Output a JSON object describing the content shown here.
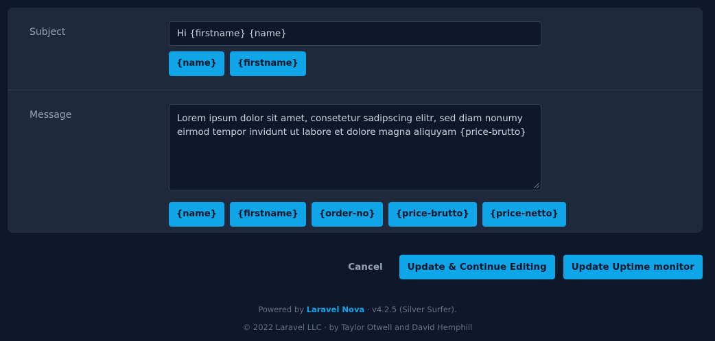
{
  "form": {
    "subject": {
      "label": "Subject",
      "value": "Hi {firstname} {name}",
      "tags": [
        "{name}",
        "{firstname}"
      ]
    },
    "message": {
      "label": "Message",
      "value": "Lorem ipsum dolor sit amet, consetetur sadipscing elitr, sed diam nonumy eirmod tempor invidunt ut labore et dolore magna aliquyam {price-brutto}",
      "tags": [
        "{name}",
        "{firstname}",
        "{order-no}",
        "{price-brutto}",
        "{price-netto}"
      ]
    }
  },
  "actions": {
    "cancel_label": "Cancel",
    "continue_label": "Update & Continue Editing",
    "update_label": "Update Uptime monitor"
  },
  "footer": {
    "powered_prefix": "Powered by",
    "powered_link": "Laravel Nova",
    "powered_suffix": "· v4.2.5 (Silver Surfer).",
    "copyright": "© 2022 Laravel LLC · by Taylor Otwell and David Hemphill"
  },
  "colors": {
    "background": "#0f172a",
    "card": "#1e293b",
    "accent": "#0ea5e9",
    "border": "#334155",
    "muted_text": "#94a3b8"
  }
}
